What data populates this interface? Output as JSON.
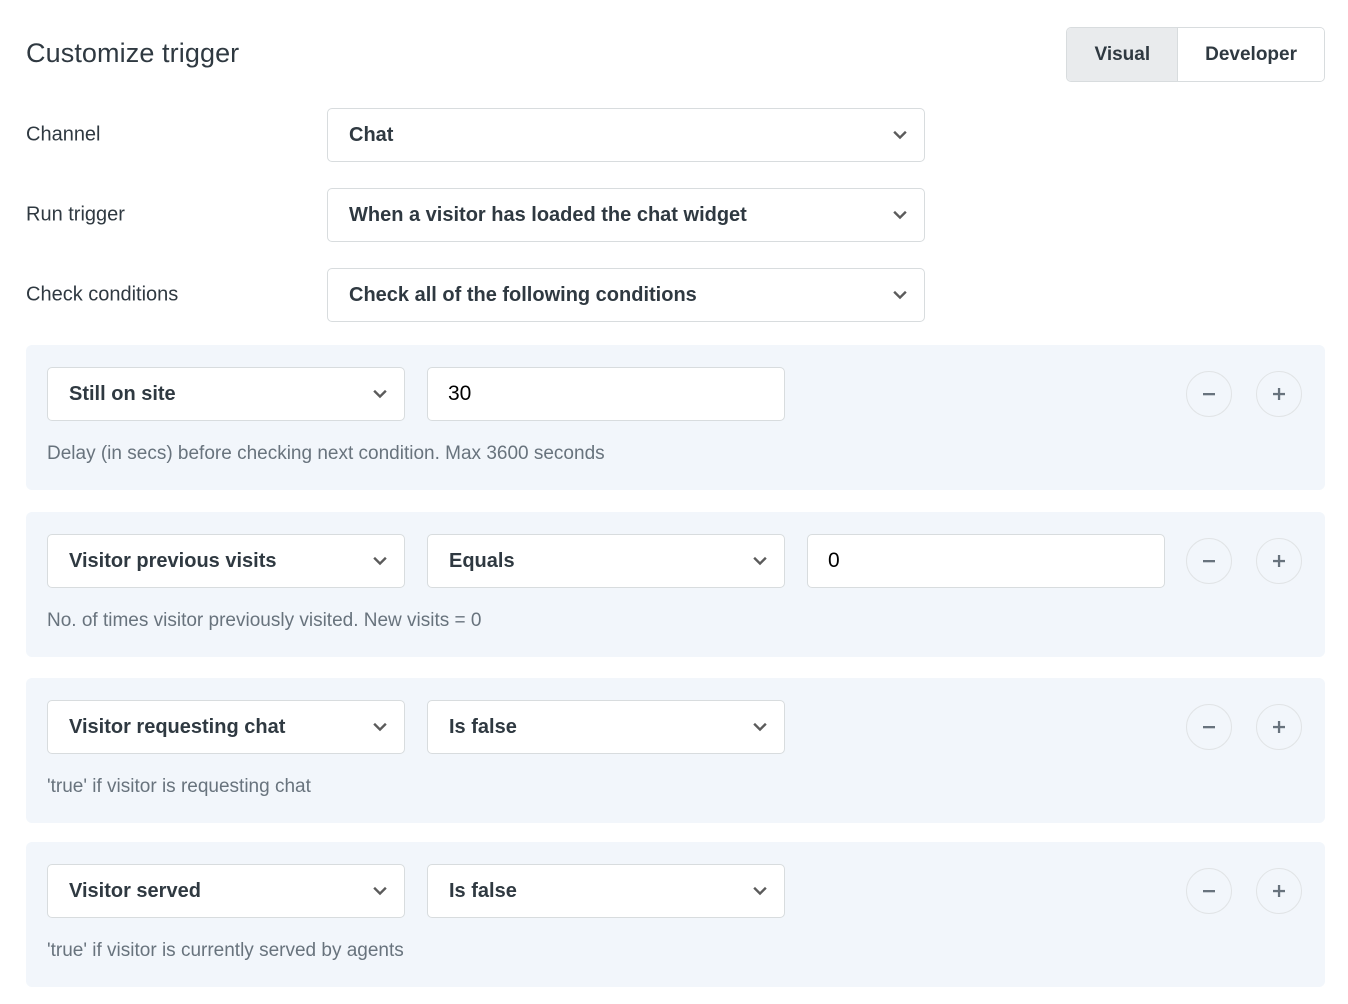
{
  "header": {
    "title": "Customize trigger",
    "mode_options": [
      "Visual",
      "Developer"
    ],
    "mode_selected": "Visual"
  },
  "form": {
    "rows": [
      {
        "label": "Channel",
        "value": "Chat"
      },
      {
        "label": "Run trigger",
        "value": "When a visitor has loaded the chat widget"
      },
      {
        "label": "Check conditions",
        "value": "Check all of the following conditions"
      }
    ]
  },
  "conditions": [
    {
      "attribute": "Still on site",
      "operator": null,
      "input_value": "30",
      "hint": "Delay (in secs) before checking next condition. Max 3600 seconds"
    },
    {
      "attribute": "Visitor previous visits",
      "operator": "Equals",
      "input_value": "0",
      "hint": "No. of times visitor previously visited. New visits = 0"
    },
    {
      "attribute": "Visitor requesting chat",
      "operator": "Is false",
      "input_value": null,
      "hint": "'true' if visitor is requesting chat"
    },
    {
      "attribute": "Visitor served",
      "operator": "Is false",
      "input_value": null,
      "hint": "'true' if visitor is currently served by agents"
    }
  ],
  "buttons": {
    "remove_label": "−",
    "add_label": "+"
  },
  "colors": {
    "panel_background": "#f2f6fb",
    "text_primary": "#2f3941",
    "text_muted": "#68737d",
    "border": "#d8dcde",
    "toggle_active_background": "#e9ebed"
  }
}
